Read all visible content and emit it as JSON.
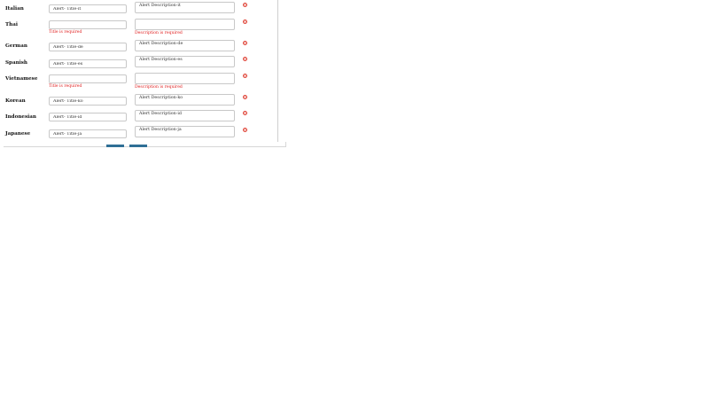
{
  "rows": [
    {
      "language": "Italian",
      "title_value": "Alert- Title-it",
      "description_value": "Alert Description-it",
      "title_error": "",
      "description_error": ""
    },
    {
      "language": "Thai",
      "title_value": "",
      "description_value": "",
      "title_error": "Title is required",
      "description_error": "Description is required"
    },
    {
      "language": "German",
      "title_value": "Alert- Title-de",
      "description_value": "Alert Description-de",
      "title_error": "",
      "description_error": ""
    },
    {
      "language": "Spanish",
      "title_value": "Alert- Title-es",
      "description_value": "Alert Description-es",
      "title_error": "",
      "description_error": ""
    },
    {
      "language": "Vietnamese",
      "title_value": "",
      "description_value": "",
      "title_error": "Title is required",
      "description_error": "Description is required"
    },
    {
      "language": "Korean",
      "title_value": "Alert- Title-ko",
      "description_value": "Alert Description-ko",
      "title_error": "",
      "description_error": ""
    },
    {
      "language": "Indonesian",
      "title_value": "Alert- Title-id",
      "description_value": "Alert Description-id",
      "title_error": "",
      "description_error": ""
    },
    {
      "language": "Japanese",
      "title_value": "Alert- Title-ja",
      "description_value": "Alert Description-ja",
      "title_error": "",
      "description_error": ""
    }
  ],
  "icons": {
    "remove": "remove-circle-icon"
  },
  "colors": {
    "error": "#e02020",
    "remove_icon": "#e0463a",
    "button": "#2f6f96"
  }
}
